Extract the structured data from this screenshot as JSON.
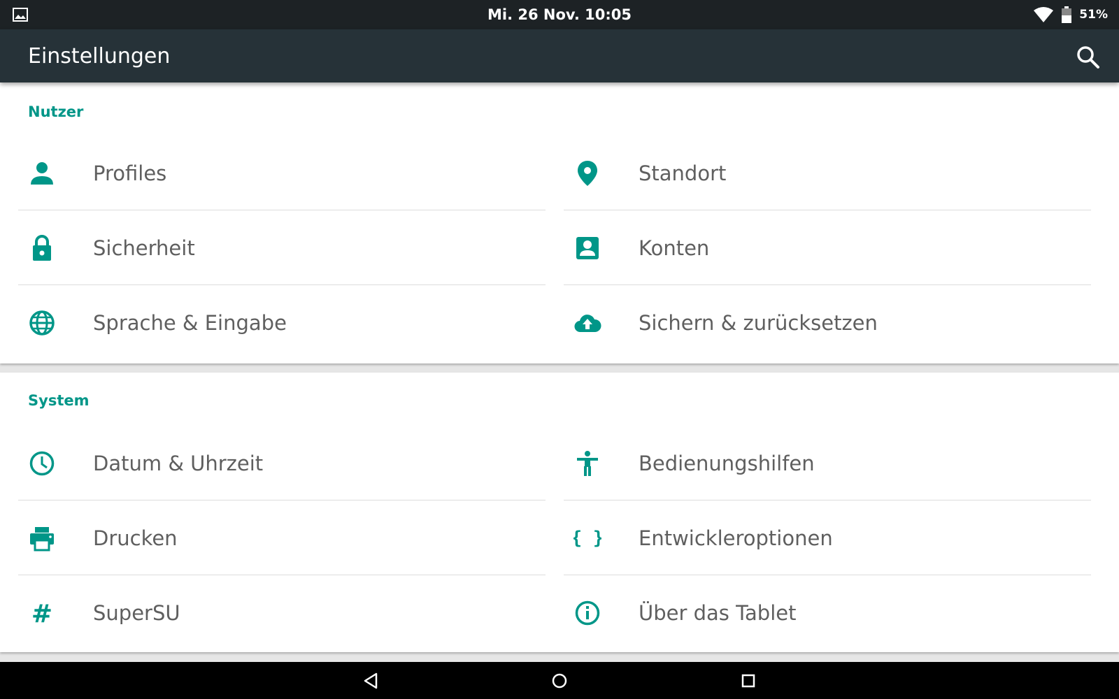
{
  "status_bar": {
    "datetime": "Mi. 26 Nov. 10:05",
    "battery": "51%",
    "icons": [
      "image-notification-icon",
      "wifi-icon",
      "battery-icon"
    ]
  },
  "app_bar": {
    "title": "Einstellungen",
    "search_icon": "search-icon"
  },
  "colors": {
    "accent": "#009688",
    "app_bar": "#263238",
    "status_bar": "#1d2225",
    "item_text": "#5f5f5f"
  },
  "sections": [
    {
      "title": "Nutzer",
      "items": [
        {
          "label": "Profiles",
          "icon": "person-icon"
        },
        {
          "label": "Standort",
          "icon": "location-pin-icon"
        },
        {
          "label": "Sicherheit",
          "icon": "lock-icon"
        },
        {
          "label": "Konten",
          "icon": "account-box-icon"
        },
        {
          "label": "Sprache & Eingabe",
          "icon": "globe-icon"
        },
        {
          "label": "Sichern & zurücksetzen",
          "icon": "cloud-upload-icon"
        }
      ]
    },
    {
      "title": "System",
      "items": [
        {
          "label": "Datum & Uhrzeit",
          "icon": "clock-icon"
        },
        {
          "label": "Bedienungshilfen",
          "icon": "accessibility-icon"
        },
        {
          "label": "Drucken",
          "icon": "printer-icon"
        },
        {
          "label": "Entwickleroptionen",
          "icon": "developer-braces-icon"
        },
        {
          "label": "SuperSU",
          "icon": "hash-icon"
        },
        {
          "label": "Über das Tablet",
          "icon": "info-icon"
        }
      ]
    }
  ],
  "nav_bar": {
    "buttons": [
      "back-icon",
      "home-icon",
      "recents-icon"
    ]
  }
}
